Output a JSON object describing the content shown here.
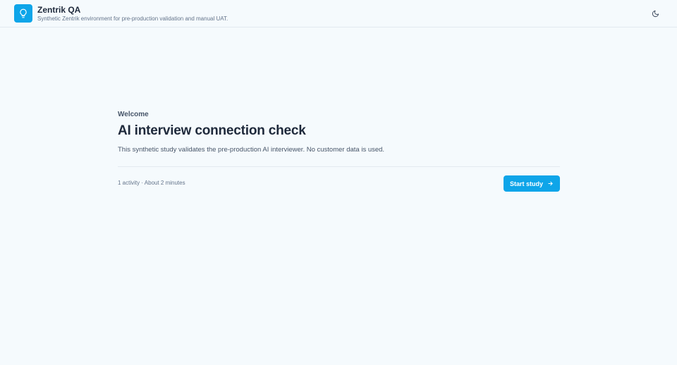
{
  "header": {
    "app_title": "Zentrik QA",
    "app_subtitle": "Synthetic Zentrik environment for pre-production validation and manual UAT.",
    "logo_icon": "lightbulb-icon",
    "theme_toggle_icon": "moon-icon"
  },
  "main": {
    "eyebrow": "Welcome",
    "title": "AI interview connection check",
    "description": "This synthetic study validates the pre-production AI interviewer. No customer data is used.",
    "meta": "1 activity · About 2 minutes",
    "start_button_label": "Start study",
    "start_button_icon": "arrow-right-icon"
  },
  "colors": {
    "accent": "#0ea5e9",
    "background": "#f5fafd",
    "text_primary": "#1e293b",
    "text_secondary": "#64748b"
  }
}
